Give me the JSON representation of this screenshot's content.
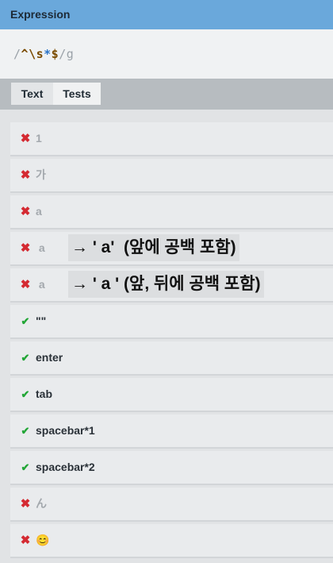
{
  "header": {
    "title": "Expression"
  },
  "expression": {
    "open_delim": "/",
    "anchor_start": "^",
    "escape": "\\s",
    "quantifier": "*",
    "anchor_end": "$",
    "close_delim": "/",
    "flags": "g"
  },
  "tabs": [
    {
      "label": "Text",
      "active": false
    },
    {
      "label": "Tests",
      "active": true
    }
  ],
  "tests": [
    {
      "status": "fail",
      "text": "1"
    },
    {
      "status": "fail",
      "text": "가"
    },
    {
      "status": "fail",
      "text": "a"
    },
    {
      "status": "fail",
      "text": " a",
      "note": "→ ' a'  (앞에 공백 포함)"
    },
    {
      "status": "fail",
      "text": " a ",
      "note": "→ ' a ' (앞, 뒤에 공백 포함)"
    },
    {
      "status": "pass",
      "text": "\"\""
    },
    {
      "status": "pass",
      "text": "enter"
    },
    {
      "status": "pass",
      "text": "tab"
    },
    {
      "status": "pass",
      "text": "spacebar*1"
    },
    {
      "status": "pass",
      "text": "spacebar*2"
    },
    {
      "status": "fail",
      "text": "ん"
    },
    {
      "status": "fail",
      "text": "😊"
    }
  ],
  "icons": {
    "fail": "✖",
    "pass": "✔"
  },
  "colors": {
    "header": "#6aa8db",
    "fail": "#d42a32",
    "pass": "#22a636"
  }
}
